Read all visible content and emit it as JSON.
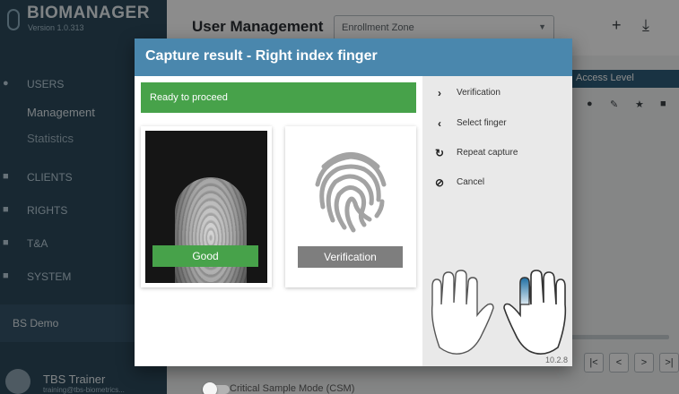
{
  "app": {
    "brand_name": "BIOMANAGER",
    "version": "Version 1.0.313",
    "page_title": "User Management",
    "zone_select_value": "Enrollment Zone",
    "table_header": "Access Level"
  },
  "sidebar": {
    "users_label": "USERS",
    "sub_management": "Management",
    "sub_statistics": "Statistics",
    "clients_label": "CLIENTS",
    "rights_label": "RIGHTS",
    "ta_label": "T&A",
    "system_label": "SYSTEM",
    "demo_label": "BS Demo",
    "user_name": "TBS Trainer",
    "user_email": "training@tbs-biometrics..."
  },
  "modal": {
    "title": "Capture result - Right index finger",
    "status_text": "Ready to proceed",
    "status_color": "#47a24a",
    "quality_button": "Good",
    "verification_button": "Verification",
    "csm_label": "Critical Sample Mode (CSM)",
    "csm_enabled": false,
    "version": "10.2.8",
    "menu": [
      {
        "icon": "chevron-right-icon",
        "label": "Verification"
      },
      {
        "icon": "chevron-left-icon",
        "label": "Select finger"
      },
      {
        "icon": "repeat-icon",
        "label": "Repeat capture"
      },
      {
        "icon": "cancel-icon",
        "label": "Cancel"
      }
    ],
    "selected_finger": "right-index"
  }
}
